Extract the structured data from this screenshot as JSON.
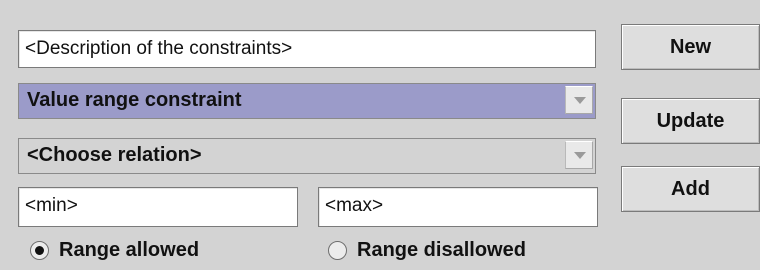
{
  "description_field": {
    "value": "<Description of the constraints>"
  },
  "constraint_type_combo": {
    "selected": "Value range constraint"
  },
  "relation_combo": {
    "selected": "<Choose relation>"
  },
  "min_field": {
    "value": "<min>"
  },
  "max_field": {
    "value": "<max>"
  },
  "range_options": {
    "allowed_label": "Range allowed",
    "disallowed_label": "Range disallowed",
    "selected": "allowed"
  },
  "buttons": {
    "new_label": "New",
    "update_label": "Update",
    "add_label": "Add"
  },
  "colors": {
    "panel_background": "#d3d3d3",
    "selected_combo_background": "#9b9bc9"
  },
  "icons": [
    "dropdown-arrow-icon",
    "radio-checked-icon",
    "radio-unchecked-icon"
  ]
}
